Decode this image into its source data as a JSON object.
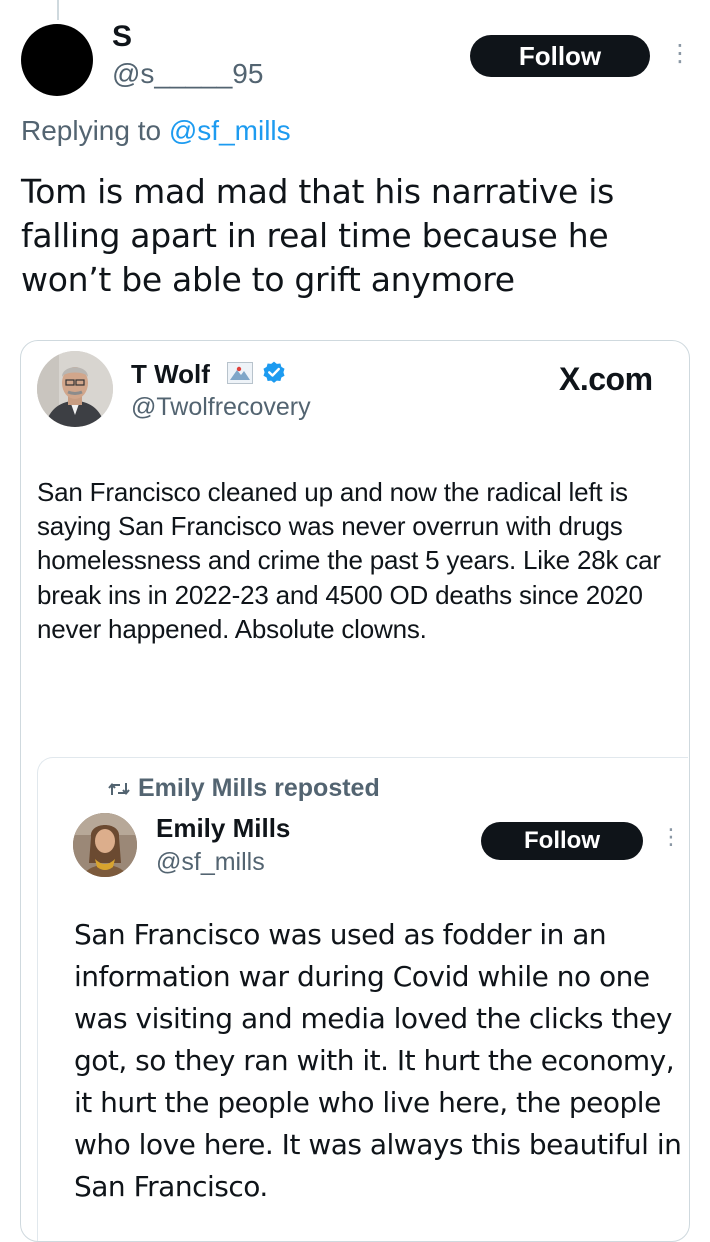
{
  "tweet": {
    "name": "S",
    "handle": "@s_____95",
    "follow_label": "Follow",
    "reply_prefix": "Replying to",
    "reply_mention": "@sf_mills",
    "text": "Tom is mad mad that his narrative is falling apart in real time because he won’t be able to grift anymore"
  },
  "quoted": {
    "name": "T Wolf",
    "handle": "@Twolfrecovery",
    "source": "X.com",
    "text": "San Francisco cleaned up and now the radical left is saying San Francisco was never overrun with drugs homelessness and crime the past 5 years. Like 28k car break ins in 2022-23 and 4500 OD deaths since 2020 never happened. Absolute clowns."
  },
  "reposted": {
    "repost_label": "Emily Mills reposted",
    "name": "Emily Mills",
    "handle": "@sf_mills",
    "follow_label": "Follow",
    "text": "San Francisco was used as fodder in an information war during Covid while no one was visiting and media loved the clicks they got, so they ran with it. It hurt the economy, it hurt the people who live here, the people who love here. It was always this beautiful in San Francisco."
  },
  "colors": {
    "text": "#0f1419",
    "secondary": "#536471",
    "accent": "#1d9bf0",
    "button": "#0f1419",
    "border": "#cfd9de"
  },
  "icons": [
    "kebab-menu-icon",
    "verified-badge-icon",
    "flag-emoji-icon",
    "repost-icon"
  ]
}
